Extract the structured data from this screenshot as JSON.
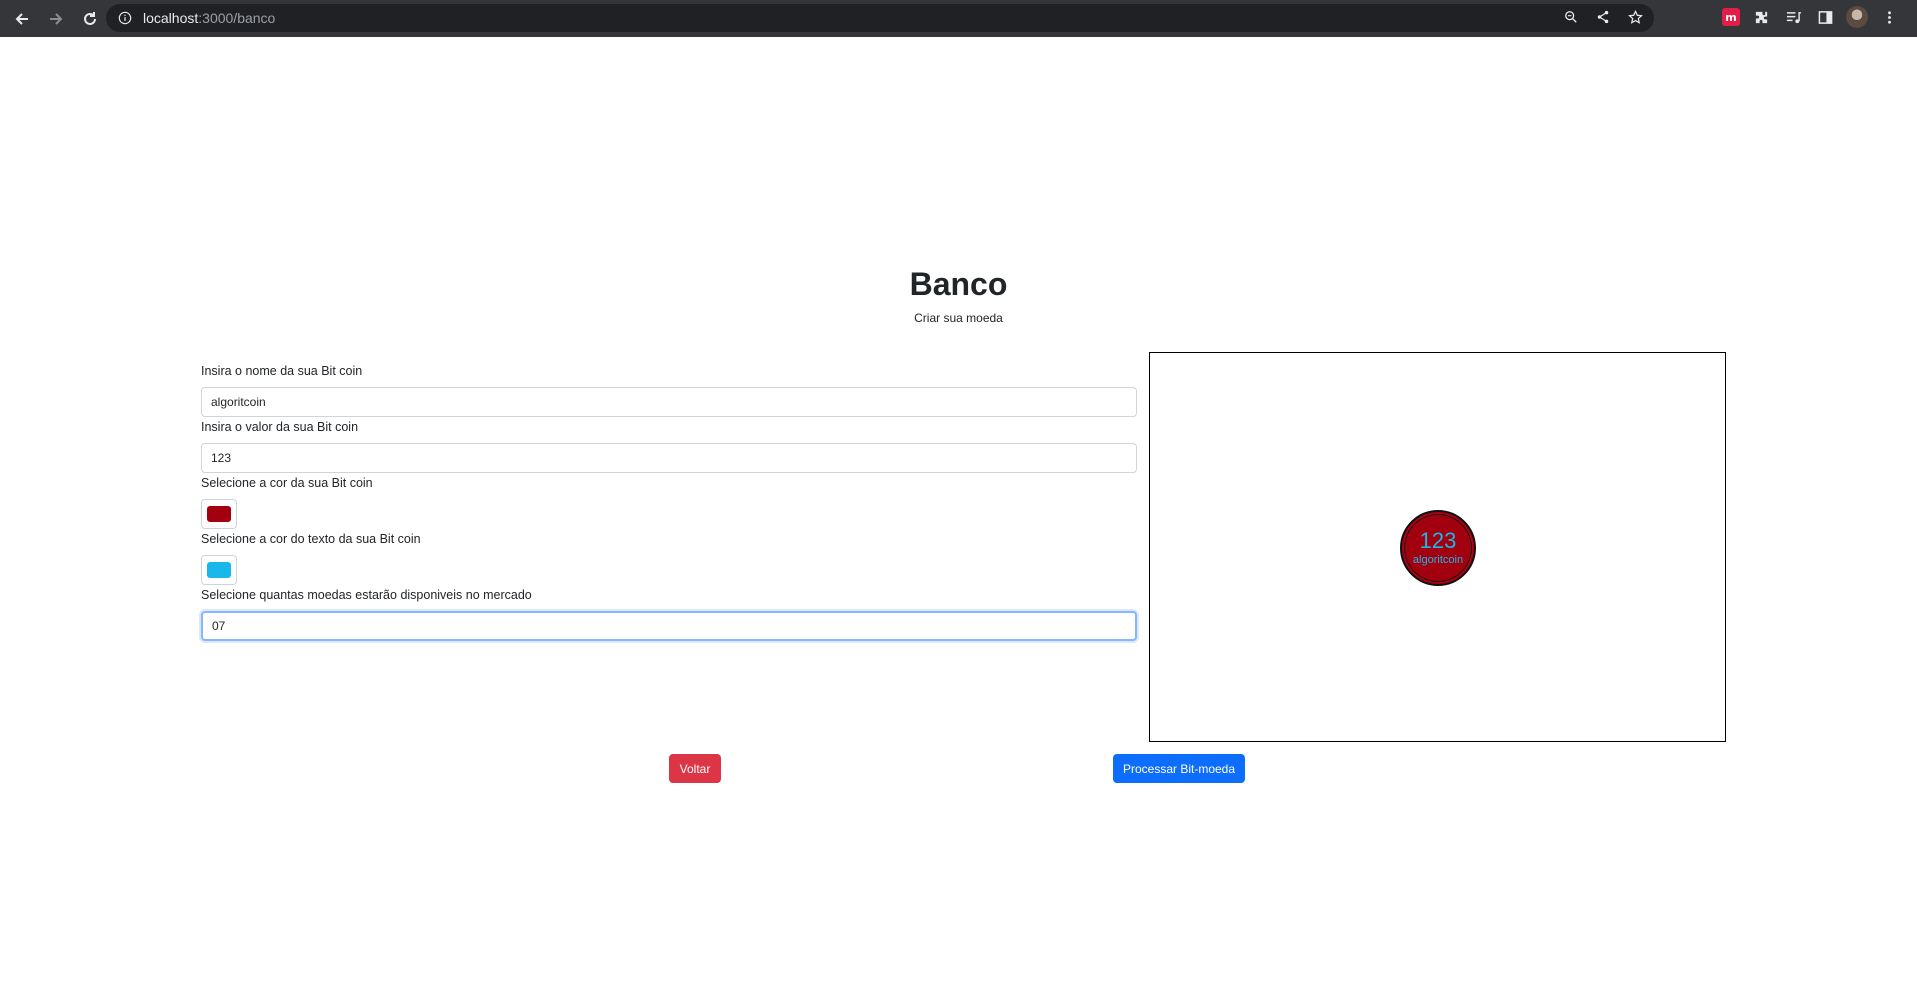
{
  "browser": {
    "url_host": "localhost",
    "url_path": ":3000/banco"
  },
  "page": {
    "title": "Banco",
    "subtitle": "Criar sua moeda"
  },
  "form": {
    "name_label": "Insira o nome da sua Bit coin",
    "name_value": "algoritcoin",
    "value_label": "Insira o valor da sua Bit coin",
    "value_value": "123",
    "color_label": "Selecione a cor da sua Bit coin",
    "color_value": "#a3000f",
    "text_color_label": "Selecione a cor do texto da sua Bit coin",
    "text_color_value": "#1ab8ea",
    "quantity_label": "Selecione quantas moedas estarão disponiveis no mercado",
    "quantity_value": "07"
  },
  "coin": {
    "value": "123",
    "name": "algoritcoin"
  },
  "buttons": {
    "back": "Voltar",
    "process": "Processar Bit-moeda"
  },
  "colors": {
    "danger": "#dc3545",
    "primary": "#0d6efd"
  },
  "icons": {
    "nav": [
      "back-arrow-icon",
      "forward-arrow-icon",
      "reload-icon"
    ],
    "omnibox": [
      "info-icon",
      "zoom-icon",
      "share-icon",
      "star-icon"
    ],
    "toolbar": [
      "extension-red-icon",
      "puzzle-icon",
      "media-icon",
      "side-panel-icon",
      "profile-avatar",
      "menu-kebab-icon"
    ]
  }
}
